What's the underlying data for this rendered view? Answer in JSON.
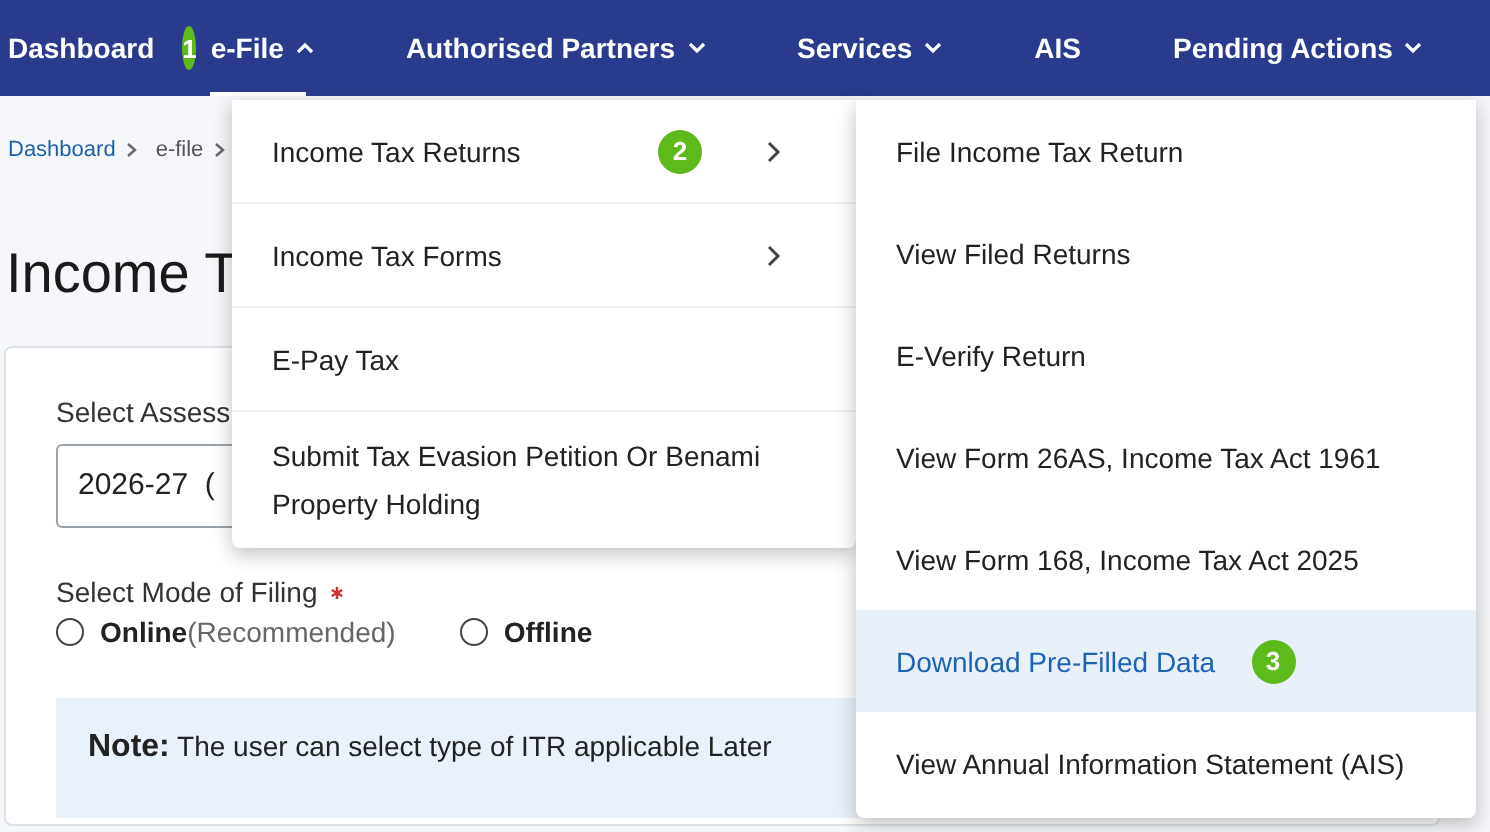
{
  "nav": {
    "items": [
      {
        "label": "Dashboard",
        "selected": false,
        "has_caret": false
      },
      {
        "label": "e-File",
        "selected": true,
        "has_caret": true,
        "step": "1"
      },
      {
        "label": "Authorised Partners",
        "selected": false,
        "has_caret": true
      },
      {
        "label": "Services",
        "selected": false,
        "has_caret": true
      },
      {
        "label": "AIS",
        "selected": false,
        "has_caret": false
      },
      {
        "label": "Pending Actions",
        "selected": false,
        "has_caret": true
      }
    ]
  },
  "breadcrumb": [
    {
      "label": "Dashboard",
      "kind": "link"
    },
    {
      "label": "e-file",
      "kind": "text"
    }
  ],
  "page_title": "Income T",
  "form": {
    "assessment_year_label": "Select Assess",
    "assessment_year_value": "2026-27  (",
    "mode_label": "Select Mode of Filing",
    "mode_required": true,
    "radios": [
      {
        "label": "Online",
        "hint": "(Recommended)",
        "selected": false
      },
      {
        "label": "Offline",
        "selected": false
      }
    ],
    "note": {
      "label": "Note:",
      "text": "The user can select type of ITR applicable Later"
    }
  },
  "efile_menu": {
    "items": [
      {
        "label": "Income Tax Returns",
        "has_submenu": true,
        "step": "2"
      },
      {
        "label": "Income Tax Forms",
        "has_submenu": true
      },
      {
        "label": "E-Pay Tax",
        "has_submenu": false
      },
      {
        "label": "Submit Tax Evasion Petition Or Benami Property Holding",
        "has_submenu": false
      }
    ]
  },
  "returns_submenu": {
    "items": [
      {
        "label": "File Income Tax Return",
        "selected": false
      },
      {
        "label": "View Filed Returns",
        "selected": false
      },
      {
        "label": "E-Verify Return",
        "selected": false
      },
      {
        "label": "View Form 26AS, Income Tax Act 1961",
        "selected": false
      },
      {
        "label": "View Form 168, Income Tax Act 2025",
        "selected": false
      },
      {
        "label": "Download Pre-Filled Data",
        "selected": true,
        "step": "3"
      },
      {
        "label": "View Annual Information Statement (AIS)",
        "selected": false
      }
    ]
  }
}
